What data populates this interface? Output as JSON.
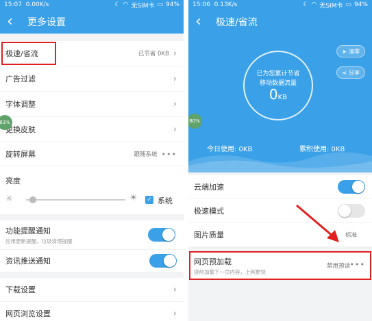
{
  "left": {
    "status": {
      "time": "15:07",
      "speed": "0.00K/s",
      "carrier": "无SIM卡",
      "battery": "94%"
    },
    "title": "更多设置",
    "rows": {
      "speed_saving": {
        "label": "极速/省流",
        "value": "已节省 0KB"
      },
      "ad_filter": {
        "label": "广告过滤"
      },
      "font_adjust": {
        "label": "字体调整"
      },
      "change_skin": {
        "label": "更换皮肤"
      },
      "rotate_screen": {
        "label": "旋转屏幕",
        "value": "跟随系统"
      },
      "brightness": {
        "label": "亮度",
        "system_label": "系统"
      },
      "feature_notify": {
        "label": "功能提醒通知",
        "sub": "应用更新提醒，垃圾清理提醒"
      },
      "news_push": {
        "label": "资讯推送通知"
      },
      "download_settings": {
        "label": "下载设置"
      },
      "web_browse_settings": {
        "label": "网页浏览设置"
      }
    },
    "badge": "83%"
  },
  "right": {
    "status": {
      "time": "15:06",
      "speed": "0.13K/s",
      "carrier": "无SIM卡",
      "battery": "94%"
    },
    "title": "极速/省流",
    "hero": {
      "saved_caption_line1": "已为您累计节省",
      "saved_caption_line2": "移动数据流量",
      "saved_value": "0",
      "saved_unit": "KB",
      "clear_label": "清零",
      "share_label": "分享",
      "today_usage": "今日使用: 0KB",
      "total_usage": "累积使用: 0KB"
    },
    "badge": "80%",
    "rows": {
      "cloud_accel": {
        "label": "云端加速"
      },
      "extreme_mode": {
        "label": "极速模式"
      },
      "image_quality": {
        "label": "图片质量",
        "value": "标准"
      },
      "page_preload": {
        "label": "网页预加载",
        "sub": "提前加载下一页内容，上网更快",
        "value": "禁用预读"
      }
    }
  },
  "colors": {
    "brand_blue": "#3aa0e8",
    "highlight_red": "#e02020"
  }
}
